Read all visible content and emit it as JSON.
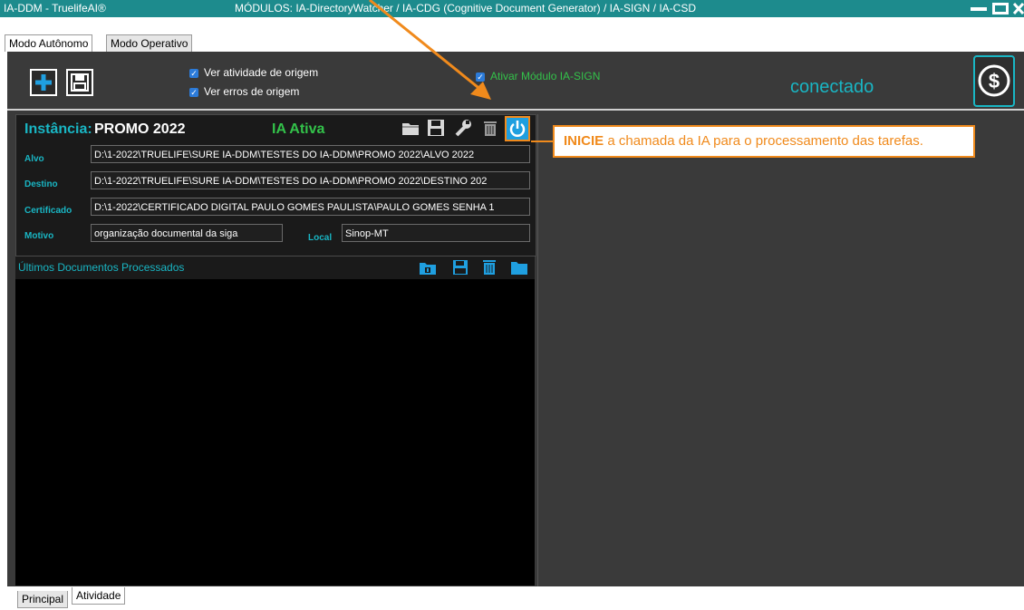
{
  "window": {
    "app_title": "IA-DDM  -  TruelifeAI®",
    "modules_title": "MÓDULOS:  IA-DirectoryWatcher / IA-CDG (Cognitive Document Generator) / IA-SIGN / IA-CSD",
    "controls": [
      "minimize-icon",
      "maximize-icon",
      "close-icon"
    ]
  },
  "top_tabs": [
    {
      "label": "Modo Autônomo",
      "active": true
    },
    {
      "label": "Modo Operativo",
      "active": false
    }
  ],
  "toolbar": {
    "add_icon": "plus-icon",
    "save_icon": "floppy-icon",
    "checkboxes": [
      {
        "label": "Ver atividade de origem",
        "checked": true
      },
      {
        "label": "Ver erros de origem",
        "checked": true
      }
    ],
    "sign_checkbox": {
      "label": "Ativar Módulo IA-SIGN",
      "checked": true
    },
    "status": "conectado",
    "dollar_icon": "dollar-circle-icon"
  },
  "instance": {
    "label": "Instância:",
    "name": "PROMO 2022",
    "status": "IA Ativa",
    "fields": {
      "alvo": {
        "label": "Alvo",
        "value": "D:\\1-2022\\TRUELIFE\\SURE IA-DDM\\TESTES DO IA-DDM\\PROMO 2022\\ALVO 2022"
      },
      "destino": {
        "label": "Destino",
        "value": "D:\\1-2022\\TRUELIFE\\SURE IA-DDM\\TESTES DO IA-DDM\\PROMO 2022\\DESTINO 202"
      },
      "certificado": {
        "label": "Certificado",
        "value": "D:\\1-2022\\CERTIFICADO DIGITAL PAULO GOMES PAULISTA\\PAULO GOMES SENHA 1"
      },
      "motivo": {
        "label": "Motivo",
        "value": "organização documental da siga"
      },
      "local": {
        "label": "Local",
        "value": "Sinop-MT"
      }
    },
    "tools": [
      "folder-icon",
      "floppy-icon",
      "wrench-icon",
      "trash-icon",
      "power-icon"
    ]
  },
  "recent_docs": {
    "title": "Últimos Documentos Processados",
    "tools": [
      "archive-icon",
      "floppy-icon",
      "trash-icon",
      "folder-icon"
    ]
  },
  "bottom_tabs": [
    {
      "label": "Principal",
      "active": false
    },
    {
      "label": "Atividade",
      "active": true
    }
  ],
  "annotation": {
    "bold": "INICIE",
    "text": " a chamada da IA para o processamento das tarefas."
  },
  "colors": {
    "titlebar": "#1d8b8d",
    "accent": "#19b6c4",
    "green": "#33c24a",
    "annotation": "#f08a1c",
    "panel_bg": "#3a3a3a"
  }
}
